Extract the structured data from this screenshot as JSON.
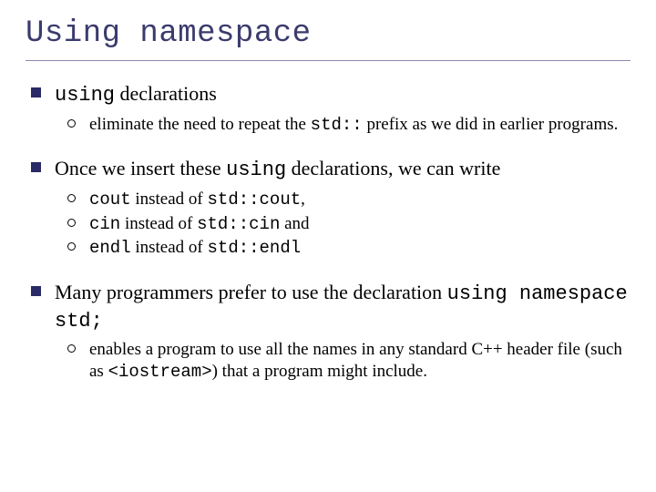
{
  "title": "Using namespace",
  "bullets": [
    {
      "runs": [
        {
          "text": "using",
          "mono": true
        },
        {
          "text": " declarations"
        }
      ],
      "sub": [
        {
          "runs": [
            {
              "text": "eliminate the need to repeat the "
            },
            {
              "text": "std::",
              "mono": true
            },
            {
              "text": " prefix as we did in earlier programs."
            }
          ]
        }
      ]
    },
    {
      "runs": [
        {
          "text": "Once we insert these "
        },
        {
          "text": "using",
          "mono": true
        },
        {
          "text": " declarations, we can write"
        }
      ],
      "sub": [
        {
          "runs": [
            {
              "text": "cout",
              "mono": true
            },
            {
              "text": " instead of "
            },
            {
              "text": "std::cout",
              "mono": true
            },
            {
              "text": ","
            }
          ]
        },
        {
          "runs": [
            {
              "text": "cin",
              "mono": true
            },
            {
              "text": " instead of "
            },
            {
              "text": "std::cin",
              "mono": true
            },
            {
              "text": " and"
            }
          ]
        },
        {
          "runs": [
            {
              "text": "endl",
              "mono": true
            },
            {
              "text": " instead of "
            },
            {
              "text": "std::endl",
              "mono": true
            }
          ]
        }
      ]
    },
    {
      "runs": [
        {
          "text": "Many programmers prefer to use the declaration "
        },
        {
          "text": "using namespace std;",
          "mono": true
        }
      ],
      "sub": [
        {
          "runs": [
            {
              "text": "enables a program to use all the names in any standard C++ header file (such as "
            },
            {
              "text": "<iostream>",
              "mono": true
            },
            {
              "text": ") that a program might include."
            }
          ]
        }
      ]
    }
  ]
}
